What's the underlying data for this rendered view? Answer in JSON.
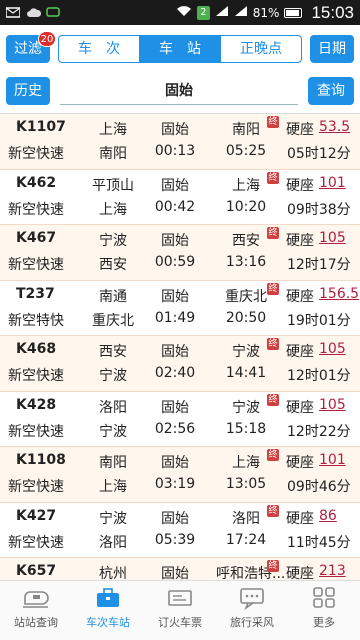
{
  "status": {
    "battery": "81%",
    "time": "15:03",
    "sim": "2"
  },
  "header": {
    "filter_label": "过滤",
    "badge_count": "20",
    "tabs": [
      {
        "label": "车　次"
      },
      {
        "label": "车　站"
      },
      {
        "label": "正晚点"
      }
    ],
    "date_label": "日期",
    "history_label": "历史",
    "station": "固始",
    "query_label": "查询"
  },
  "trains": [
    {
      "code": "K1107",
      "type": "新空快速",
      "from": "上海",
      "from2": "南阳",
      "at": "固始",
      "at_time": "00:13",
      "to": "南阳",
      "to_time": "05:25",
      "end": "终",
      "seat": "硬座",
      "price": "53.5",
      "duration": "05时12分"
    },
    {
      "code": "K462",
      "type": "新空快速",
      "from": "平顶山",
      "from2": "上海",
      "at": "固始",
      "at_time": "00:42",
      "to": "上海",
      "to_time": "10:20",
      "end": "终",
      "seat": "硬座",
      "price": "101",
      "duration": "09时38分"
    },
    {
      "code": "K467",
      "type": "新空快速",
      "from": "宁波",
      "from2": "西安",
      "at": "固始",
      "at_time": "00:59",
      "to": "西安",
      "to_time": "13:16",
      "end": "终",
      "seat": "硬座",
      "price": "105",
      "duration": "12时17分"
    },
    {
      "code": "T237",
      "type": "新空特快",
      "from": "南通",
      "from2": "重庆北",
      "at": "固始",
      "at_time": "01:49",
      "to": "重庆北",
      "to_time": "20:50",
      "end": "终",
      "seat": "硬座",
      "price": "156.5",
      "duration": "19时01分"
    },
    {
      "code": "K468",
      "type": "新空快速",
      "from": "西安",
      "from2": "宁波",
      "at": "固始",
      "at_time": "02:40",
      "to": "宁波",
      "to_time": "14:41",
      "end": "终",
      "seat": "硬座",
      "price": "105",
      "duration": "12时01分"
    },
    {
      "code": "K428",
      "type": "新空快速",
      "from": "洛阳",
      "from2": "宁波",
      "at": "固始",
      "at_time": "02:56",
      "to": "宁波",
      "to_time": "15:18",
      "end": "终",
      "seat": "硬座",
      "price": "105",
      "duration": "12时22分"
    },
    {
      "code": "K1108",
      "type": "新空快速",
      "from": "南阳",
      "from2": "上海",
      "at": "固始",
      "at_time": "03:19",
      "to": "上海",
      "to_time": "13:05",
      "end": "终",
      "seat": "硬座",
      "price": "101",
      "duration": "09时46分"
    },
    {
      "code": "K427",
      "type": "新空快速",
      "from": "宁波",
      "from2": "洛阳",
      "at": "固始",
      "at_time": "05:39",
      "to": "洛阳",
      "to_time": "17:24",
      "end": "终",
      "seat": "硬座",
      "price": "86",
      "duration": "11时45分"
    },
    {
      "code": "K657",
      "type": "",
      "from": "杭州",
      "from2": "",
      "at": "固始",
      "at_time": "",
      "to": "呼和浩特...",
      "to_time": "",
      "end": "终",
      "seat": "硬座",
      "price": "213",
      "duration": ""
    }
  ],
  "tabbar": [
    {
      "label": "站站查询",
      "icon": "train-icon"
    },
    {
      "label": "车次车站",
      "icon": "briefcase-icon"
    },
    {
      "label": "订火车票",
      "icon": "ticket-icon"
    },
    {
      "label": "旅行采风",
      "icon": "chat-icon"
    },
    {
      "label": "更多",
      "icon": "grid-icon"
    }
  ],
  "colors": {
    "accent": "#1e90e6",
    "price": "#b02040",
    "row_alt": "#fff6ee"
  }
}
